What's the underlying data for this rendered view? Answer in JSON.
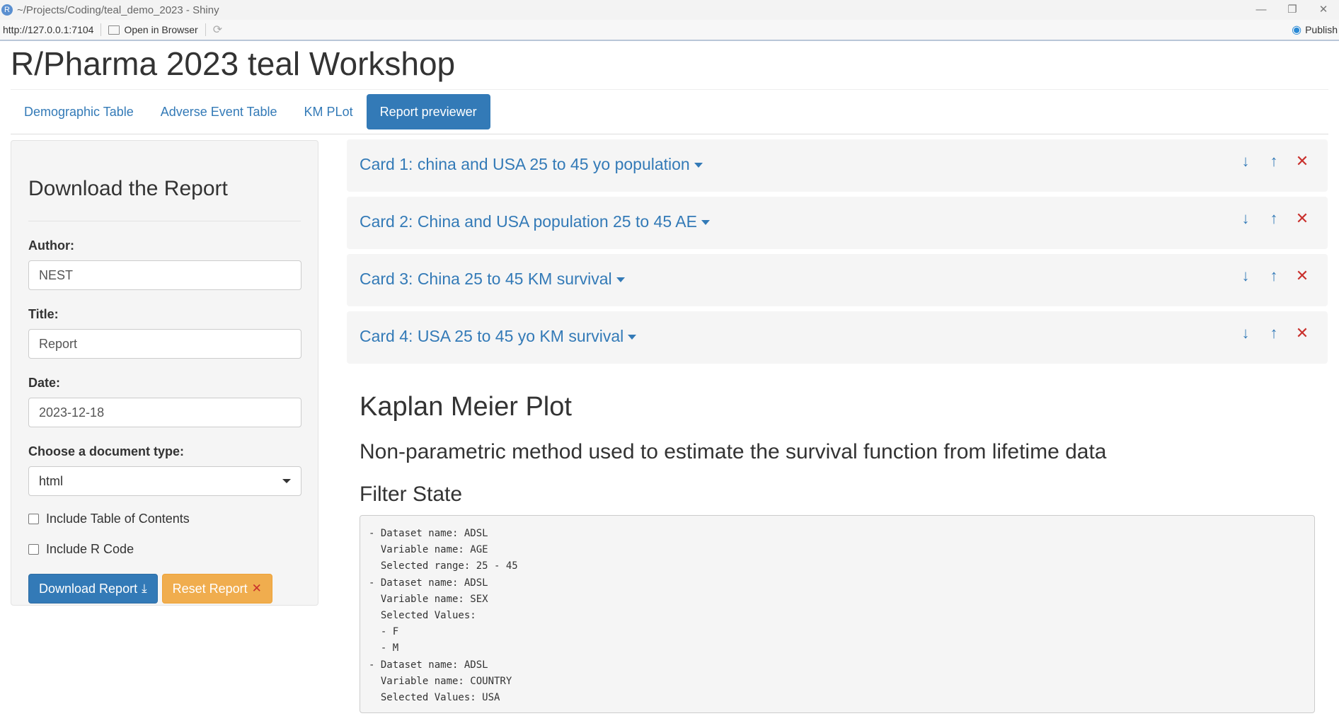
{
  "window": {
    "title": "~/Projects/Coding/teal_demo_2023 - Shiny",
    "app_icon": "R",
    "controls": [
      "—",
      "❐",
      "✕"
    ]
  },
  "viewer_toolbar": {
    "url": "http://127.0.0.1:7104",
    "open_in_browser": "Open in Browser",
    "publish": "Publish"
  },
  "app": {
    "title": "R/Pharma 2023 teal Workshop",
    "tabs": [
      {
        "label": "Demographic Table",
        "active": false
      },
      {
        "label": "Adverse Event Table",
        "active": false
      },
      {
        "label": "KM PLot",
        "active": false
      },
      {
        "label": "Report previewer",
        "active": true
      }
    ]
  },
  "sidebar": {
    "heading": "Download the Report",
    "author_label": "Author:",
    "author_value": "NEST",
    "title_label": "Title:",
    "title_value": "Report",
    "date_label": "Date:",
    "date_value": "2023-12-18",
    "doctype_label": "Choose a document type:",
    "doctype_value": "html",
    "include_toc_label": "Include Table of Contents",
    "include_toc_checked": false,
    "include_rcode_label": "Include R Code",
    "include_rcode_checked": false,
    "download_button": "Download Report",
    "reset_button": "Reset Report"
  },
  "cards": [
    {
      "title": "Card 1: china and USA 25 to 45 yo population"
    },
    {
      "title": "Card 2: China and USA population 25 to 45 AE"
    },
    {
      "title": "Card 3: China 25 to 45 KM survival"
    },
    {
      "title": "Card 4: USA 25 to 45 yo KM survival"
    }
  ],
  "report": {
    "heading": "Kaplan Meier Plot",
    "subheading": "Non-parametric method used to estimate the survival function from lifetime data",
    "filter_heading": "Filter State",
    "filter_code": "- Dataset name: ADSL\n  Variable name: AGE\n  Selected range: 25 - 45\n- Dataset name: ADSL\n  Variable name: SEX\n  Selected Values:\n  - F\n  - M\n- Dataset name: ADSL\n  Variable name: COUNTRY\n  Selected Values: USA"
  },
  "colors": {
    "primary": "#337ab7",
    "warning": "#f0ad4e",
    "danger": "#c9302c",
    "well": "#f5f5f5"
  }
}
